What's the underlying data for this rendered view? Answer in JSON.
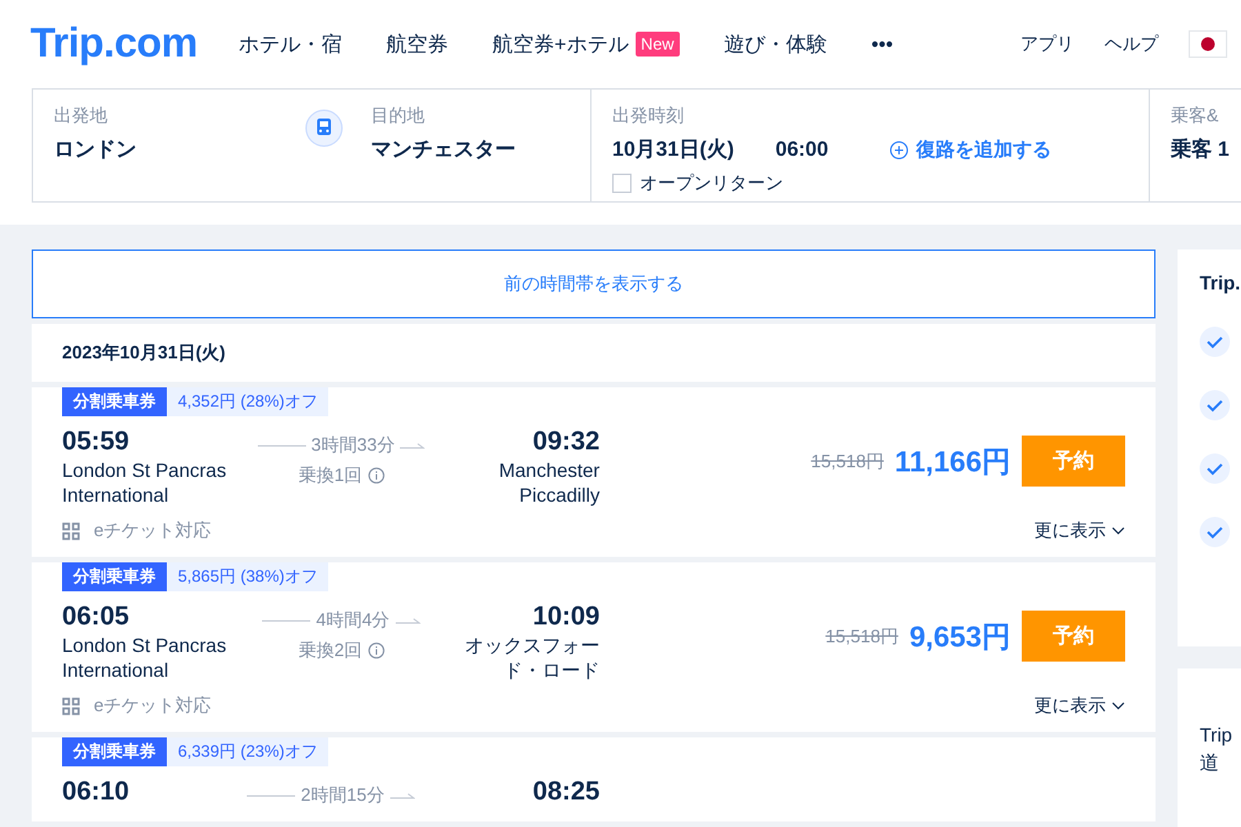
{
  "header": {
    "logo": "Trip.com",
    "nav": [
      {
        "label": "ホテル・宿"
      },
      {
        "label": "航空券"
      },
      {
        "label": "航空券+ホテル",
        "badge": "New"
      },
      {
        "label": "遊び・体験"
      },
      {
        "label": "•••"
      }
    ],
    "links": [
      "アプリ",
      "ヘルプ"
    ]
  },
  "search": {
    "from_label": "出発地",
    "from": "ロンドン",
    "to_label": "目的地",
    "to": "マンチェスター",
    "time_label": "出発時刻",
    "date": "10月31日(火)",
    "time": "06:00",
    "add_return": "復路を追加する",
    "open_return": {
      "label": "オープンリターン",
      "checked": false
    },
    "passengers_label": "乗客&",
    "passengers": "乗客 1"
  },
  "earlier_button": "前の時間帯を表示する",
  "date_heading": "2023年10月31日(火)",
  "trains": [
    {
      "badge": "分割乗車券",
      "saving": "4,352円 (28%)オフ",
      "depart": "05:59",
      "from": "London St Pancras International",
      "duration": "3時間33分",
      "changes": "乗換1回",
      "arrive": "09:32",
      "to": "Manchester Piccadilly",
      "eticket": "eチケット対応",
      "old_price": "15,518円",
      "price": "11,166円",
      "book": "予約",
      "more": "更に表示"
    },
    {
      "badge": "分割乗車券",
      "saving": "5,865円 (38%)オフ",
      "depart": "06:05",
      "from": "London St Pancras International",
      "duration": "4時間4分",
      "changes": "乗換2回",
      "arrive": "10:09",
      "to": "オックスフォード・ロード",
      "eticket": "eチケット対応",
      "old_price": "15,518円",
      "price": "9,653円",
      "book": "予約",
      "more": "更に表示"
    },
    {
      "badge": "分割乗車券",
      "saving": "6,339円 (23%)オフ",
      "depart": "06:10",
      "duration": "2時間15分",
      "arrive": "08:25"
    }
  ],
  "sidebar": {
    "title": "Trip.",
    "checks": [
      {
        "checked": true
      },
      {
        "checked": true
      },
      {
        "checked": true
      },
      {
        "checked": true
      }
    ],
    "note": "Trip",
    "note_2": "道"
  }
}
